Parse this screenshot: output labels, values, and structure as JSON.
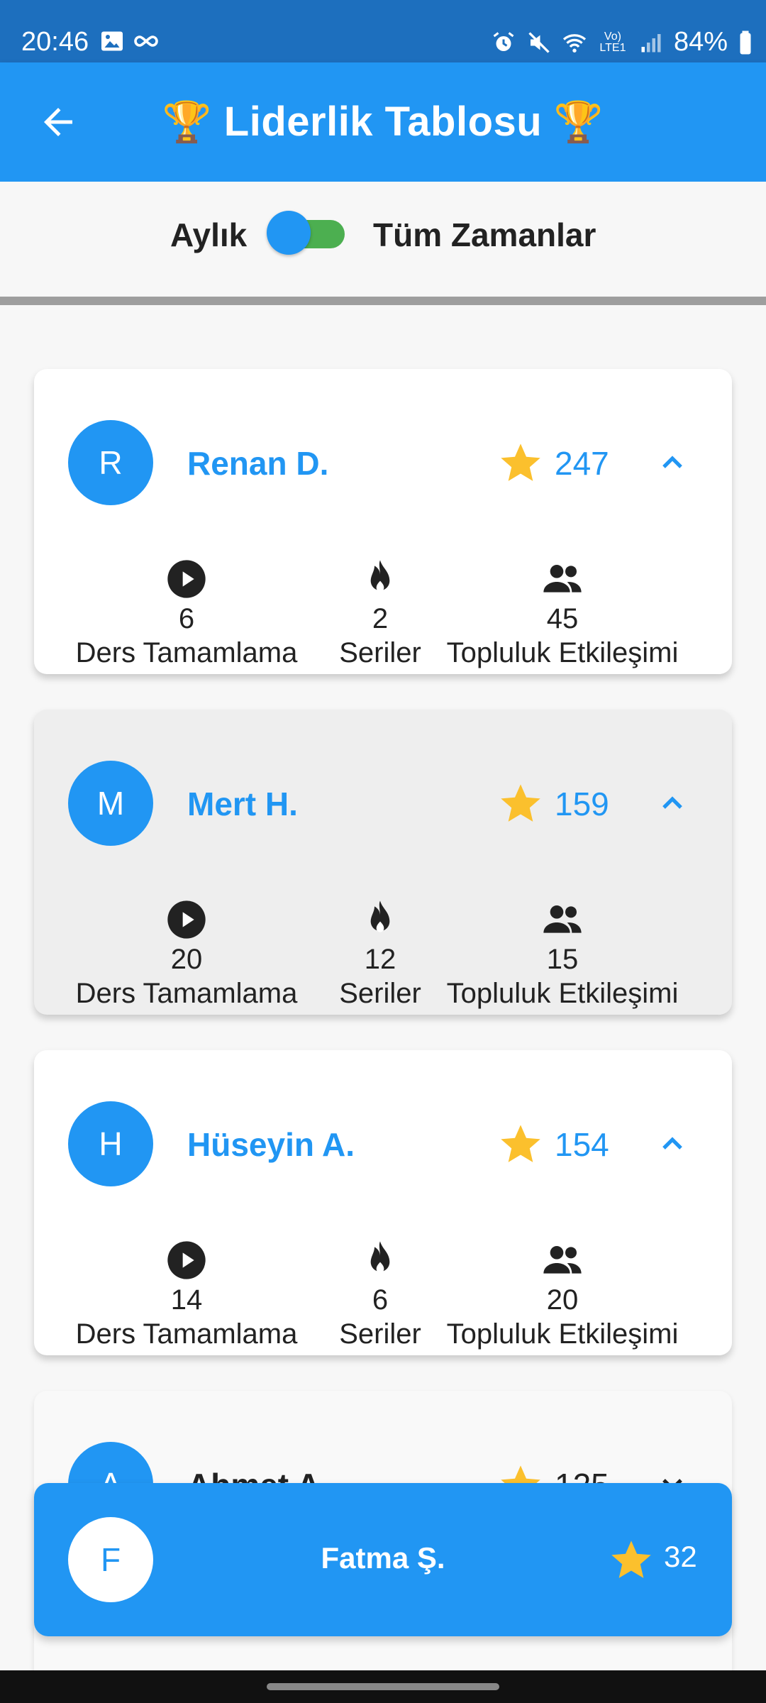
{
  "status": {
    "time": "20:46",
    "battery": "84%",
    "net_label": "Vo) LTE1"
  },
  "appbar": {
    "title": "Liderlik Tablosu",
    "trophy_left": "🏆",
    "trophy_right": "🏆"
  },
  "toggle": {
    "left_label": "Aylık",
    "right_label": "Tüm Zamanlar",
    "on": true
  },
  "entries": [
    {
      "initial": "R",
      "name": "Renan D.",
      "score": "247",
      "stats": [
        {
          "icon": "play-circle-icon",
          "value": "6",
          "label": "Ders Tamamlama"
        },
        {
          "icon": "fire-icon",
          "value": "2",
          "label": "Seriler"
        },
        {
          "icon": "people-icon",
          "value": "45",
          "label": "Topluluk Etkileşimi"
        }
      ]
    },
    {
      "initial": "M",
      "name": "Mert H.",
      "score": "159",
      "stats": [
        {
          "icon": "play-circle-icon",
          "value": "20",
          "label": "Ders Tamamlama"
        },
        {
          "icon": "fire-icon",
          "value": "12",
          "label": "Seriler"
        },
        {
          "icon": "people-icon",
          "value": "15",
          "label": "Topluluk Etkileşimi"
        }
      ]
    },
    {
      "initial": "H",
      "name": "Hüseyin A.",
      "score": "154",
      "stats": [
        {
          "icon": "play-circle-icon",
          "value": "14",
          "label": "Ders Tamamlama"
        },
        {
          "icon": "fire-icon",
          "value": "6",
          "label": "Seriler"
        },
        {
          "icon": "people-icon",
          "value": "20",
          "label": "Topluluk Etkileşimi"
        }
      ]
    },
    {
      "initial": "A",
      "name": "Ahmet A.",
      "score": "125"
    }
  ],
  "current_user": {
    "initial": "F",
    "name": "Fatma Ş.",
    "score": "32"
  },
  "colors": {
    "primary": "#2196f3",
    "statusbar": "#1d6fbe",
    "star": "#fbc02d",
    "toggle_track": "#4caf50"
  }
}
